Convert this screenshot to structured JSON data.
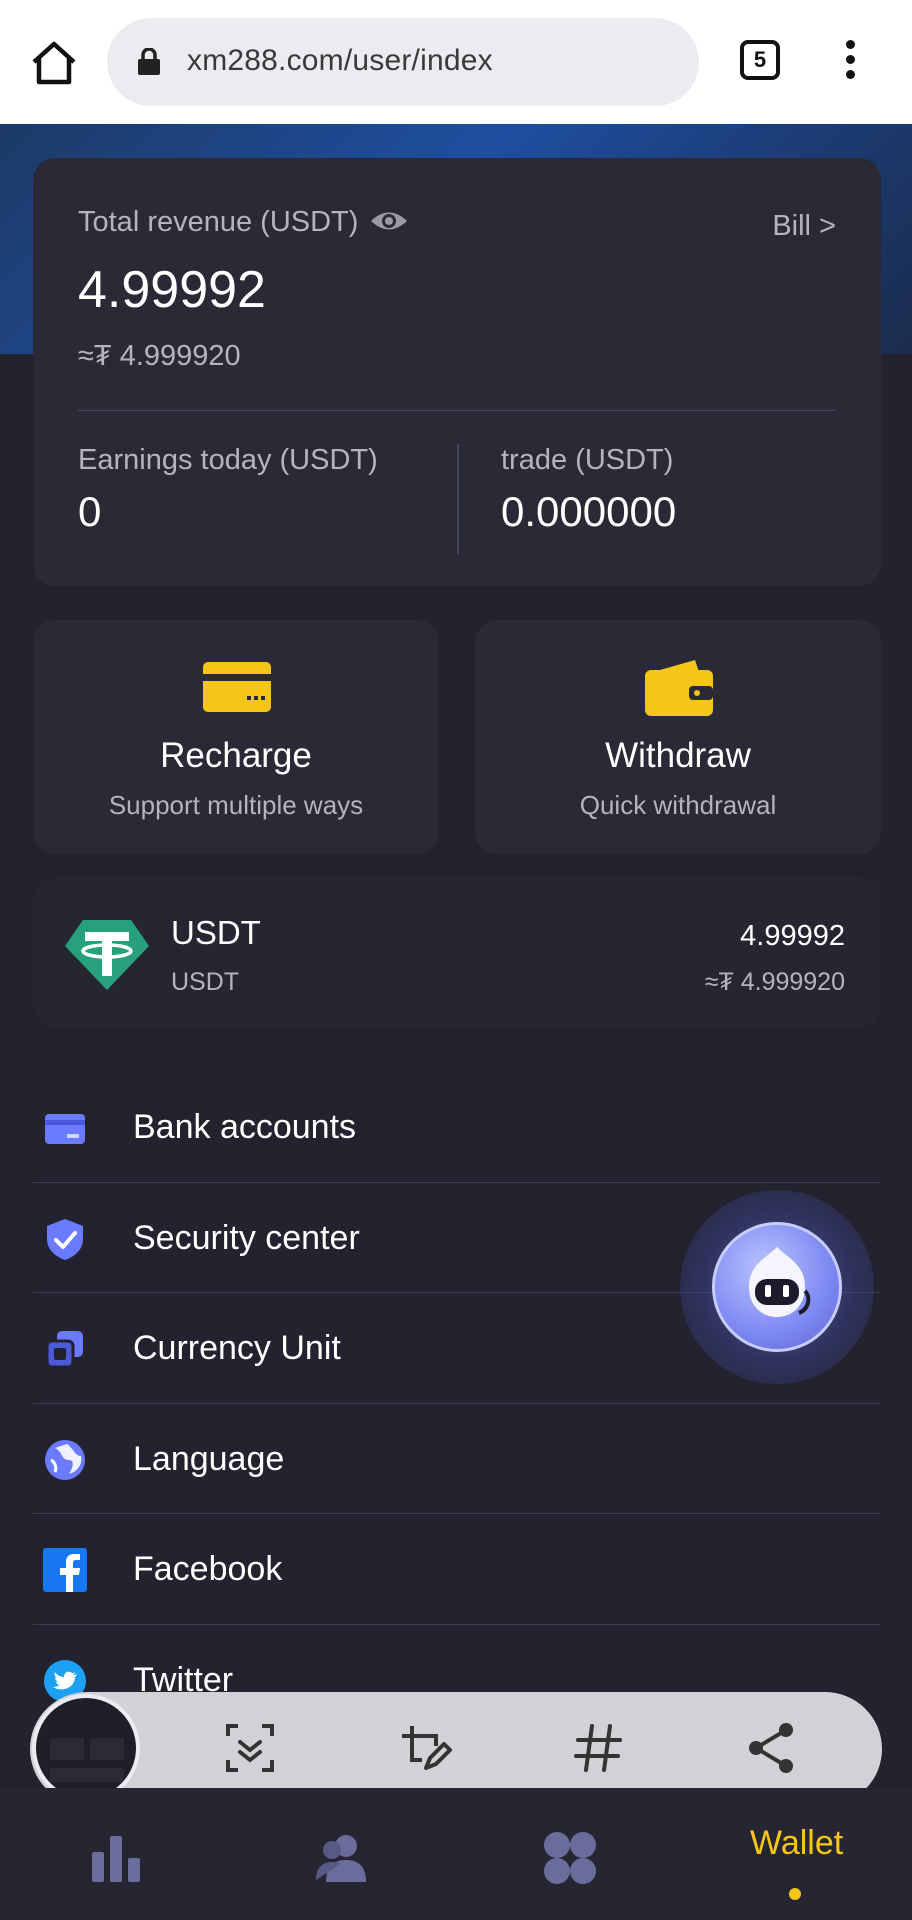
{
  "browser": {
    "url": "xm288.com/user/index",
    "tab_count": "5"
  },
  "revenue": {
    "label": "Total revenue (USDT)",
    "bill_link": "Bill >",
    "value": "4.99992",
    "fiat": "≈₮ 4.999920",
    "earnings_today_label": "Earnings today (USDT)",
    "earnings_today_value": "0",
    "trade_label": "trade (USDT)",
    "trade_value": "0.000000"
  },
  "actions": {
    "recharge_title": "Recharge",
    "recharge_sub": "Support multiple ways",
    "withdraw_title": "Withdraw",
    "withdraw_sub": "Quick withdrawal"
  },
  "asset": {
    "name": "USDT",
    "sub": "USDT",
    "value": "4.99992",
    "fiat": "≈₮ 4.999920"
  },
  "menu": [
    {
      "label": "Bank accounts",
      "icon": "bank-card-icon"
    },
    {
      "label": "Security center",
      "icon": "shield-check-icon"
    },
    {
      "label": "Currency Unit",
      "icon": "currency-stack-icon"
    },
    {
      "label": "Language",
      "icon": "globe-icon"
    },
    {
      "label": "Facebook",
      "icon": "facebook-icon"
    },
    {
      "label": "Twitter",
      "icon": "twitter-icon"
    }
  ],
  "nav": {
    "wallet_label": "Wallet"
  },
  "colors": {
    "accent": "#f5c518",
    "icon_blue": "#6a7bff",
    "card_bg": "#2a2a36",
    "page_bg": "#23232f"
  }
}
